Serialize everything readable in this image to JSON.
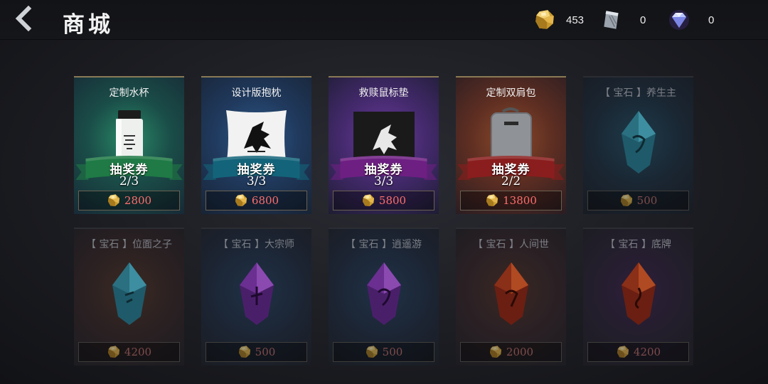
{
  "header": {
    "title": "商城",
    "currencies": [
      {
        "icon": "gold-nugget-icon",
        "value": "453"
      },
      {
        "icon": "silver-ingot-icon",
        "value": "0"
      },
      {
        "icon": "diamond-icon",
        "value": "0"
      }
    ]
  },
  "colors": {
    "price": "#ff6e6e",
    "ribbon_green": "#1f7a45",
    "ribbon_teal": "#13647a",
    "ribbon_purple": "#6e1f82",
    "ribbon_red": "#8a1d1d"
  },
  "prizes": [
    {
      "name": "定制水杯",
      "ribbon": "抽奖券",
      "count": "2/3",
      "price": "2800",
      "product": "water-bottle"
    },
    {
      "name": "设计版抱枕",
      "ribbon": "抽奖券",
      "count": "3/3",
      "price": "6800",
      "product": "pillow"
    },
    {
      "name": "救赎鼠标垫",
      "ribbon": "抽奖券",
      "count": "3/3",
      "price": "5800",
      "product": "mousepad"
    },
    {
      "name": "定制双肩包",
      "ribbon": "抽奖券",
      "count": "2/2",
      "price": "13800",
      "product": "backpack"
    }
  ],
  "gems": [
    {
      "name": "【 宝石 】养生主",
      "price": "500",
      "color": "teal"
    },
    {
      "name": "【 宝石 】位面之子",
      "price": "4200",
      "color": "teal"
    },
    {
      "name": "【 宝石 】大宗师",
      "price": "500",
      "color": "purple"
    },
    {
      "name": "【 宝石 】逍遥游",
      "price": "500",
      "color": "purple"
    },
    {
      "name": "【 宝石 】人间世",
      "price": "2000",
      "color": "red"
    },
    {
      "name": "【 宝石 】底牌",
      "price": "4200",
      "color": "red"
    }
  ]
}
